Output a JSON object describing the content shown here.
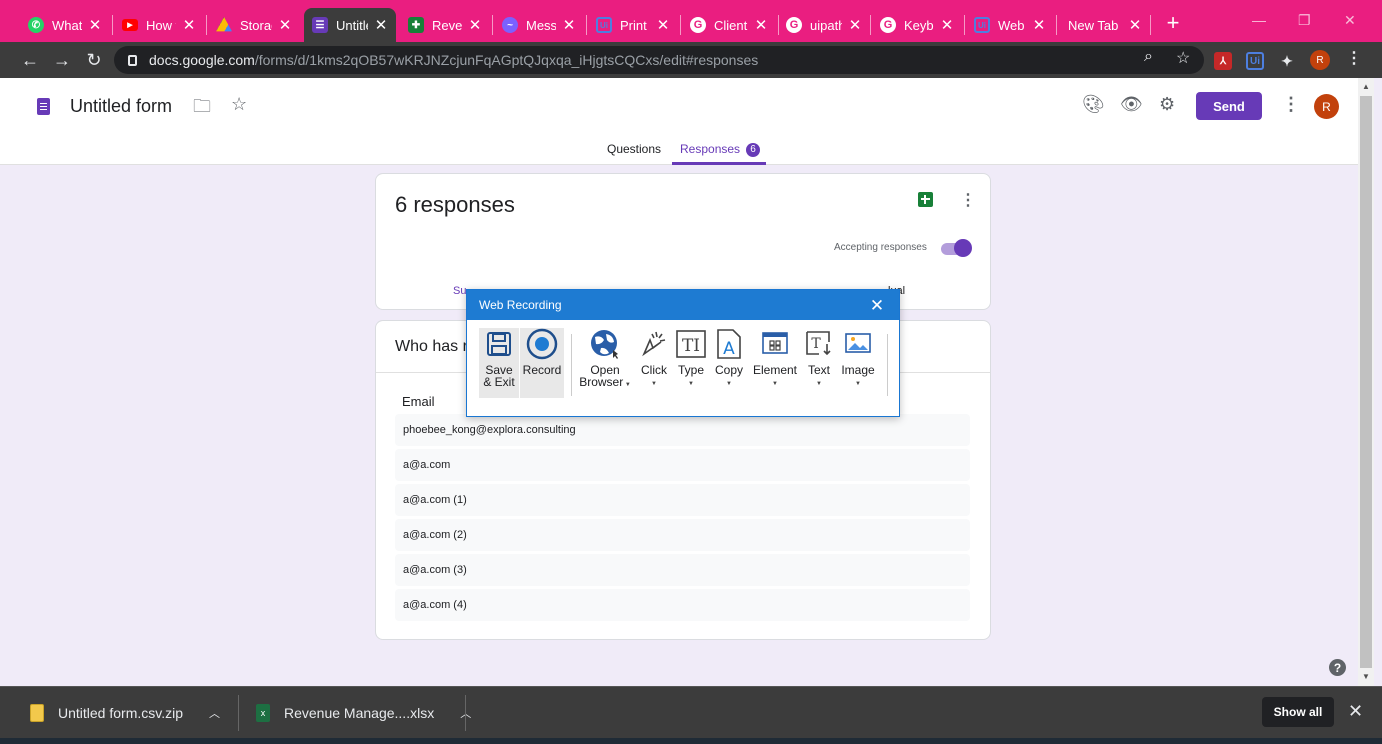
{
  "browser": {
    "tabs": [
      {
        "title": "WhatsApp",
        "icon": "whatsapp-icon",
        "color": "#25d366"
      },
      {
        "title": "How to",
        "icon": "youtube-icon",
        "color": "#ff0000"
      },
      {
        "title": "Storage",
        "icon": "google-drive-icon",
        "color": "#fbbc04"
      },
      {
        "title": "Untitled form",
        "icon": "google-forms-icon",
        "color": "#673ab7",
        "active": true
      },
      {
        "title": "Revenue",
        "icon": "google-sheets-icon",
        "color": "#188038"
      },
      {
        "title": "Messenger",
        "icon": "messenger-icon",
        "color": "#7b61ff"
      },
      {
        "title": "Print",
        "icon": "uipath-icon",
        "color": "#3a78e0"
      },
      {
        "title": "Client",
        "icon": "google-icon",
        "color": "#ffffff"
      },
      {
        "title": "uipath",
        "icon": "google-icon",
        "color": "#ffffff"
      },
      {
        "title": "Keyboard",
        "icon": "google-icon",
        "color": "#ffffff"
      },
      {
        "title": "Web Rec",
        "icon": "uipath-icon",
        "color": "#3a78e0"
      },
      {
        "title": "New Tab",
        "icon": "",
        "color": ""
      }
    ],
    "url_host": "docs.google.com",
    "url_path": "/forms/d/1kms2qOB57wKRJNZcjunFqAGptQJqxqa_iHjgtsCQCxs/edit#responses",
    "profile_initial": "R",
    "extension_label": "Ui"
  },
  "form": {
    "title": "Untitled form",
    "send_label": "Send",
    "avatar_initial": "R",
    "tabs": {
      "questions": "Questions",
      "responses": "Responses",
      "response_count": "6"
    }
  },
  "responses_card": {
    "title": "6 responses",
    "accepting_label": "Accepting responses",
    "accepting": true,
    "subtab_summary": "Su",
    "subtab_individual": "lual"
  },
  "question_card": {
    "title": "Who has r",
    "column_header": "Email",
    "rows": [
      "phoebee_kong@explora.consulting",
      "a@a.com",
      "a@a.com (1)",
      "a@a.com (2)",
      "a@a.com (3)",
      "a@a.com (4)"
    ]
  },
  "web_recording": {
    "title": "Web Recording",
    "buttons": {
      "save_line1": "Save",
      "save_line2": "& Exit",
      "record": "Record",
      "open_line1": "Open",
      "open_line2": "Browser",
      "click": "Click",
      "type": "Type",
      "copy": "Copy",
      "element": "Element",
      "text": "Text",
      "image": "Image"
    },
    "accent": "#1e7bd2"
  },
  "downloads": {
    "items": [
      {
        "name": "Untitled form.csv.zip",
        "icon": "zip-file-icon"
      },
      {
        "name": "Revenue Manage....xlsx",
        "icon": "excel-file-icon"
      }
    ],
    "show_all": "Show all"
  }
}
